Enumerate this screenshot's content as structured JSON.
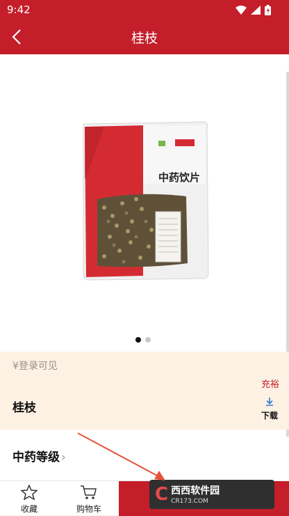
{
  "status_bar": {
    "time": "9:42"
  },
  "header": {
    "title": "桂枝"
  },
  "product": {
    "bag_label": "中药饮片",
    "price_text": "¥登录可见",
    "supply_status": "充裕",
    "name": "桂枝",
    "download_label": "下载",
    "grade_label": "中药等级",
    "grade_chevron": "›"
  },
  "carousel": {
    "total": 2,
    "active": 1
  },
  "bottom_bar": {
    "favorite_label": "收藏",
    "cart_label": "购物车"
  },
  "watermark": {
    "line1": "西西软件园",
    "line2": "CR173.COM"
  },
  "colors": {
    "primary": "#c41e2a",
    "price_bg": "#fdf1e4",
    "arrow": "#e8503a"
  }
}
